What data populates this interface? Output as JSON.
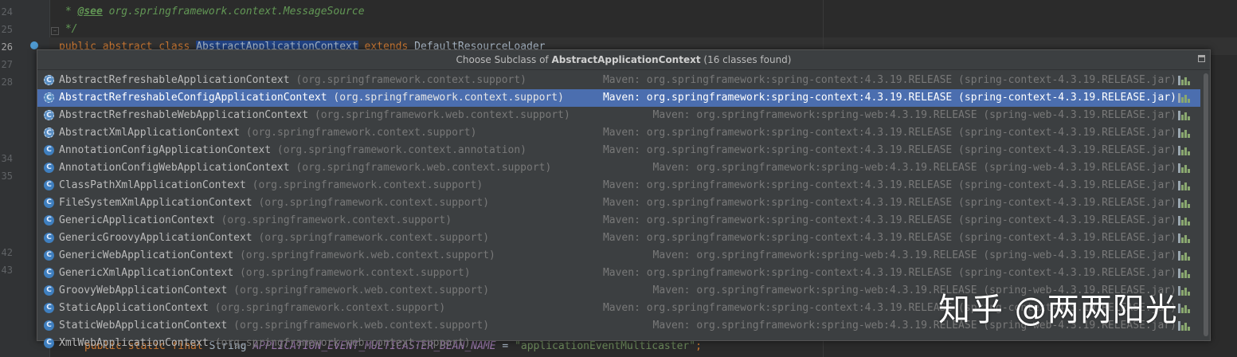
{
  "editor": {
    "line_numbers": [
      "24",
      "25",
      "26",
      "27",
      "28",
      "34",
      "35",
      "42",
      "43"
    ],
    "comment_see_tag": "@see",
    "comment_see_ref": " org.springframework.context.MessageSource",
    "comment_end": "*/",
    "decl_keywords": "public abstract class ",
    "decl_highlight": "AbstractApplicationContext",
    "decl_extends": " extends ",
    "decl_parent": "DefaultResourceLoader",
    "field_prefix": "public static final ",
    "field_type": "String ",
    "field_name": "APPLICATION_EVENT_MULTICASTER_BEAN_NAME",
    "field_eq": " = ",
    "field_value": "\"applicationEventMulticaster\"",
    "field_end": ";"
  },
  "popup": {
    "title_prefix": "Choose Subclass of ",
    "title_class": "AbstractApplicationContext",
    "title_suffix": " (16 classes found)",
    "items": [
      {
        "name": "AbstractRefreshableApplicationContext",
        "pkg": " (org.springframework.context.support)",
        "location": "Maven: org.springframework:spring-context:4.3.19.RELEASE (spring-context-4.3.19.RELEASE.jar)",
        "abstract": true,
        "selected": false
      },
      {
        "name": "AbstractRefreshableConfigApplicationContext",
        "pkg": " (org.springframework.context.support)",
        "location": "Maven: org.springframework:spring-context:4.3.19.RELEASE (spring-context-4.3.19.RELEASE.jar)",
        "abstract": true,
        "selected": true
      },
      {
        "name": "AbstractRefreshableWebApplicationContext",
        "pkg": " (org.springframework.web.context.support)",
        "location": "Maven: org.springframework:spring-web:4.3.19.RELEASE (spring-web-4.3.19.RELEASE.jar)",
        "abstract": true,
        "selected": false
      },
      {
        "name": "AbstractXmlApplicationContext",
        "pkg": " (org.springframework.context.support)",
        "location": "Maven: org.springframework:spring-context:4.3.19.RELEASE (spring-context-4.3.19.RELEASE.jar)",
        "abstract": true,
        "selected": false
      },
      {
        "name": "AnnotationConfigApplicationContext",
        "pkg": " (org.springframework.context.annotation)",
        "location": "Maven: org.springframework:spring-context:4.3.19.RELEASE (spring-context-4.3.19.RELEASE.jar)",
        "abstract": false,
        "selected": false
      },
      {
        "name": "AnnotationConfigWebApplicationContext",
        "pkg": " (org.springframework.web.context.support)",
        "location": "Maven: org.springframework:spring-web:4.3.19.RELEASE (spring-web-4.3.19.RELEASE.jar)",
        "abstract": false,
        "selected": false
      },
      {
        "name": "ClassPathXmlApplicationContext",
        "pkg": " (org.springframework.context.support)",
        "location": "Maven: org.springframework:spring-context:4.3.19.RELEASE (spring-context-4.3.19.RELEASE.jar)",
        "abstract": false,
        "selected": false
      },
      {
        "name": "FileSystemXmlApplicationContext",
        "pkg": " (org.springframework.context.support)",
        "location": "Maven: org.springframework:spring-context:4.3.19.RELEASE (spring-context-4.3.19.RELEASE.jar)",
        "abstract": false,
        "selected": false
      },
      {
        "name": "GenericApplicationContext",
        "pkg": " (org.springframework.context.support)",
        "location": "Maven: org.springframework:spring-context:4.3.19.RELEASE (spring-context-4.3.19.RELEASE.jar)",
        "abstract": false,
        "selected": false
      },
      {
        "name": "GenericGroovyApplicationContext",
        "pkg": " (org.springframework.context.support)",
        "location": "Maven: org.springframework:spring-context:4.3.19.RELEASE (spring-context-4.3.19.RELEASE.jar)",
        "abstract": false,
        "selected": false
      },
      {
        "name": "GenericWebApplicationContext",
        "pkg": " (org.springframework.web.context.support)",
        "location": "Maven: org.springframework:spring-web:4.3.19.RELEASE (spring-web-4.3.19.RELEASE.jar)",
        "abstract": false,
        "selected": false
      },
      {
        "name": "GenericXmlApplicationContext",
        "pkg": " (org.springframework.context.support)",
        "location": "Maven: org.springframework:spring-context:4.3.19.RELEASE (spring-context-4.3.19.RELEASE.jar)",
        "abstract": false,
        "selected": false
      },
      {
        "name": "GroovyWebApplicationContext",
        "pkg": " (org.springframework.web.context.support)",
        "location": "Maven: org.springframework:spring-web:4.3.19.RELEASE (spring-web-4.3.19.RELEASE.jar)",
        "abstract": false,
        "selected": false
      },
      {
        "name": "StaticApplicationContext",
        "pkg": " (org.springframework.context.support)",
        "location": "Maven: org.springframework:spring-context:4.3.19.RELEASE (spring-context-4.3.19.RELEASE.jar)",
        "abstract": false,
        "selected": false
      },
      {
        "name": "StaticWebApplicationContext",
        "pkg": " (org.springframework.web.context.support)",
        "location": "Maven: org.springframework:spring-web:4.3.19.RELEASE (spring-web-4.3.19.RELEASE.jar)",
        "abstract": false,
        "selected": false
      },
      {
        "name": "XmlWebApplicationContext",
        "pkg": " (org.springframework.web.context.support)",
        "location": "",
        "abstract": false,
        "selected": false
      }
    ],
    "class_icon_letter": "C"
  },
  "watermark": "知乎 @两两阳光",
  "colors": {
    "selection": "#4b6eaf",
    "keyword": "#cc7832",
    "comment": "#629755",
    "identifier_highlight": "#214283"
  }
}
